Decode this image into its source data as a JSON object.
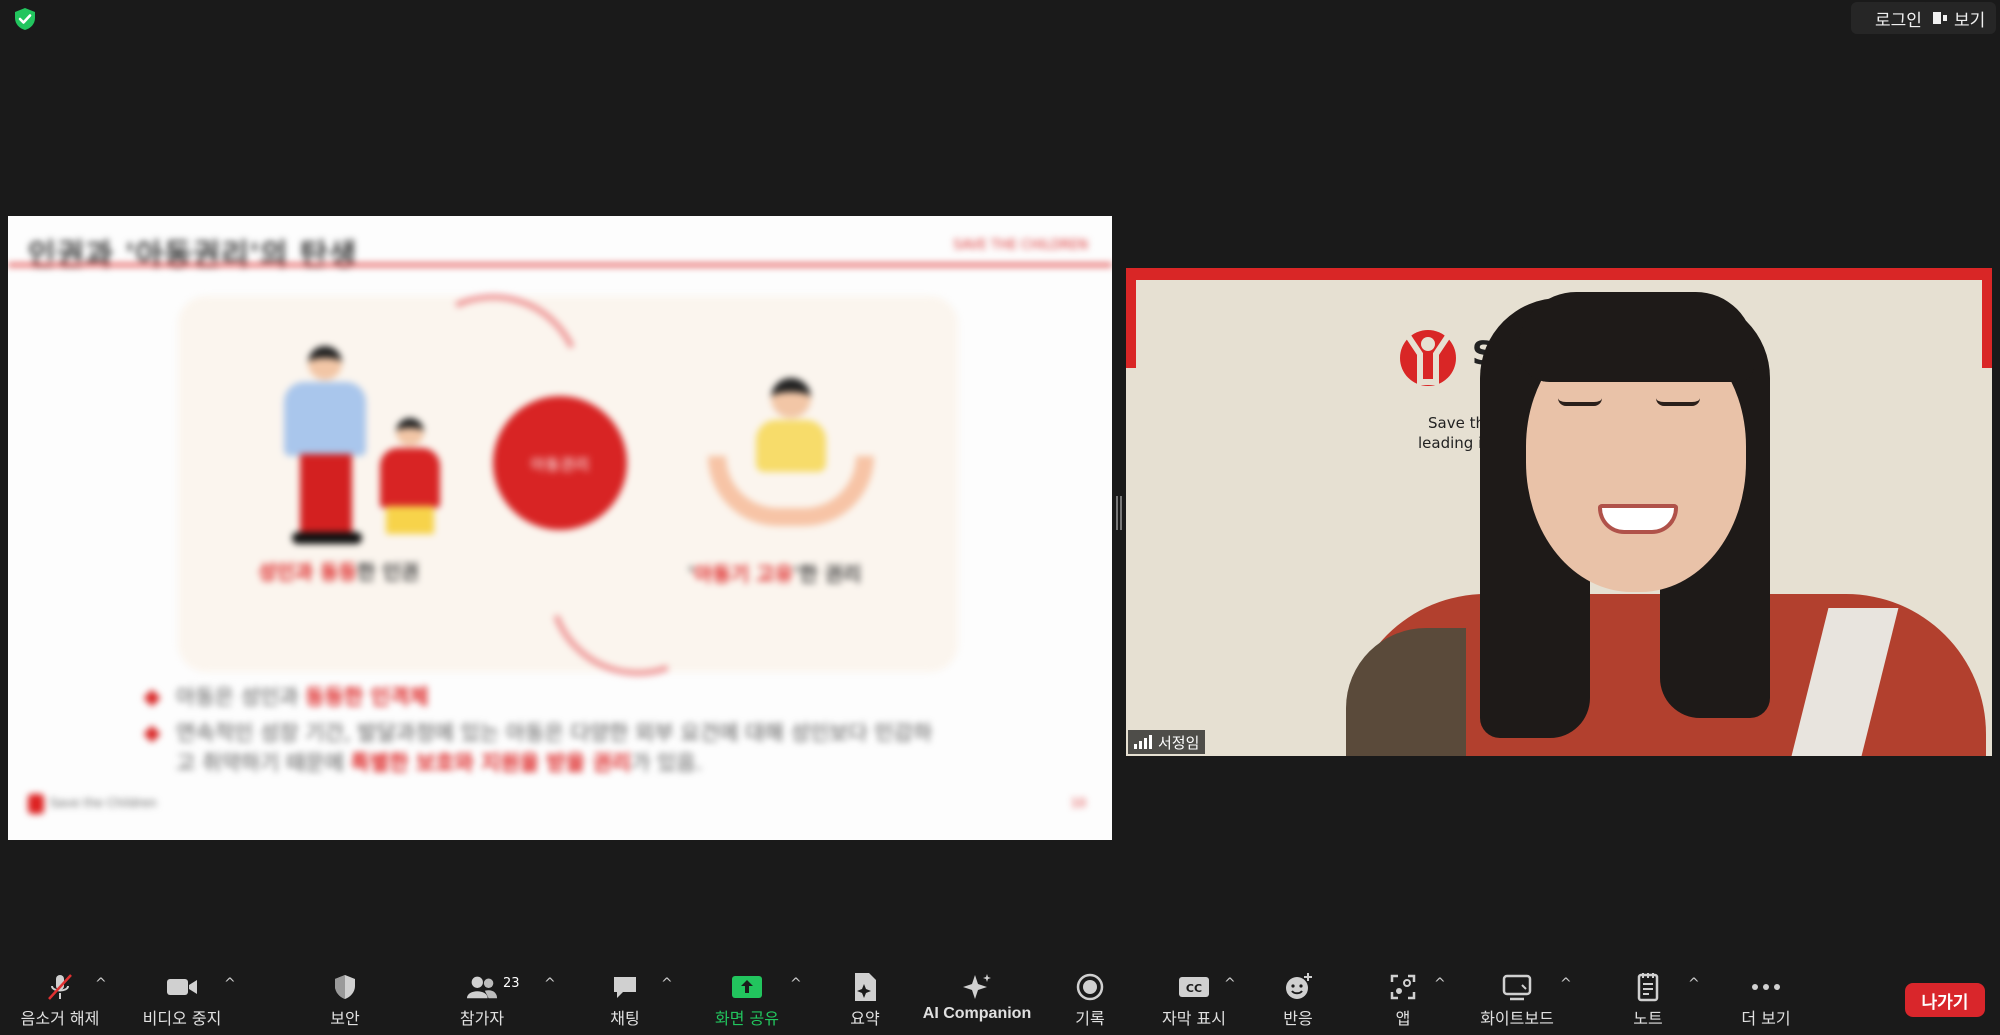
{
  "top_bar": {
    "login_label": "로그인",
    "view_label": "보기",
    "security_icon": "shield-check-icon"
  },
  "shared_slide": {
    "title": "인권과 '아동권리'의 탄생",
    "header_right": "SAVE THE CHILDREN",
    "center_circle": "아동권리",
    "caption_left_highlight": "성인과 동등",
    "caption_left_rest": "한 인권",
    "caption_right_highlight": "아동기 고유",
    "caption_right_rest": "한 권리",
    "bullet1_plain": "아동은 성인과 ",
    "bullet1_highlight": "동등한 인격체",
    "bullet2_plain": "연속적인 성장 기간, 발달과정에 있는 아동은 다양한 외부 요건에 대해 성인보다 민감하고 취약하기 때문에 ",
    "bullet2_highlight": "특별한 보호와 지원을 받을 권리",
    "bullet2_tail": "가 있음.",
    "footer_logo_text": "Save the Children",
    "page_number": "10"
  },
  "participant_video": {
    "brand_text": "Sa",
    "tagline1": "Save the C",
    "tagline2": "leading inde",
    "name": "서정임",
    "signal_icon": "signal-bars-icon"
  },
  "toolbar": {
    "items": [
      {
        "label": "음소거 해제",
        "icon": "microphone-muted-icon",
        "caret": "^"
      },
      {
        "label": "비디오 중지",
        "icon": "video-camera-icon",
        "caret": "^"
      },
      {
        "label": "보안",
        "icon": "shield-icon"
      },
      {
        "label": "참가자",
        "icon": "participants-icon",
        "count": "23",
        "caret": "^"
      },
      {
        "label": "채팅",
        "icon": "chat-bubble-icon",
        "caret": "^"
      },
      {
        "label": "화면 공유",
        "icon": "share-screen-icon",
        "caret": "^"
      },
      {
        "label": "요약",
        "icon": "summary-doc-icon"
      },
      {
        "label": "AI Companion",
        "icon": "sparkle-icon"
      },
      {
        "label": "기록",
        "icon": "record-icon"
      },
      {
        "label": "자막 표시",
        "icon": "cc-icon",
        "caret": "^"
      },
      {
        "label": "반응",
        "icon": "emoji-icon"
      },
      {
        "label": "앱",
        "icon": "apps-icon",
        "caret": "^"
      },
      {
        "label": "화이트보드",
        "icon": "whiteboard-icon",
        "caret": "^"
      },
      {
        "label": "노트",
        "icon": "notes-icon",
        "caret": "^"
      },
      {
        "label": "더 보기",
        "icon": "more-dots-icon"
      }
    ],
    "leave_label": "나가기"
  },
  "colors": {
    "background": "#1a1a1a",
    "share_green": "#22c55e",
    "leave_red": "#d9262b",
    "slide_red": "#d82424"
  }
}
